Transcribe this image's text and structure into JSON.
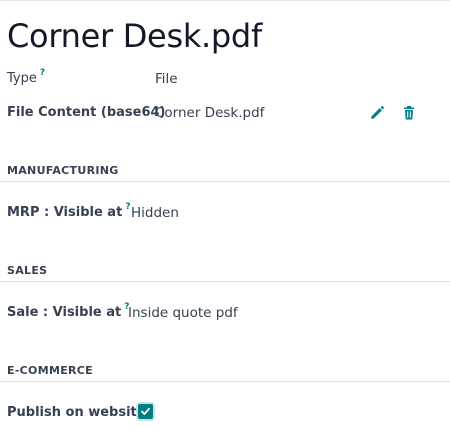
{
  "title": "Corner Desk.pdf",
  "fields": {
    "type": {
      "label": "Type",
      "help": "?",
      "value": "File"
    },
    "file_content": {
      "label": "File Content (base64)",
      "value": "Corner Desk.pdf",
      "edit_icon": "pencil-icon",
      "delete_icon": "trash-icon"
    }
  },
  "sections": {
    "manufacturing": {
      "heading": "MANUFACTURING",
      "field": {
        "label": "MRP : Visible at",
        "help": "?",
        "value": "Hidden"
      }
    },
    "sales": {
      "heading": "SALES",
      "field": {
        "label": "Sale : Visible at",
        "help": "?",
        "value": "Inside quote pdf"
      }
    },
    "ecommerce": {
      "heading": "E-COMMERCE",
      "field": {
        "label": "Publish on website",
        "checked": true,
        "checkbox_color": "#017e84"
      }
    }
  },
  "colors": {
    "accent": "#017e84",
    "text": "#374151",
    "title": "#111827"
  }
}
